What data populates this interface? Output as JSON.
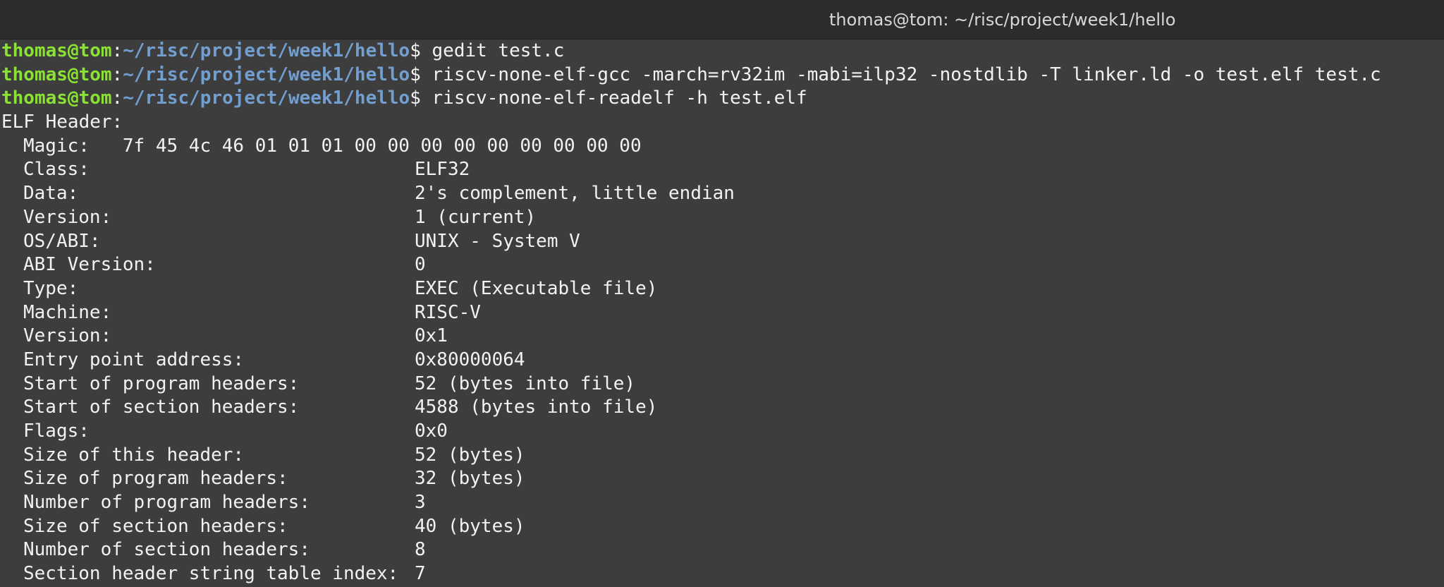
{
  "window": {
    "title": "thomas@tom: ~/risc/project/week1/hello"
  },
  "colors": {
    "background": "#3d3d3d",
    "titlebar": "#2c2c2c",
    "prompt_user": "#8ae234",
    "prompt_path": "#729fcf",
    "text": "#f2f2f2"
  },
  "prompt": {
    "user_host": "thomas@tom",
    "separator": ":",
    "path": "~/risc/project/week1/hello",
    "symbol": "$"
  },
  "commands": [
    " gedit test.c",
    " riscv-none-elf-gcc -march=rv32im -mabi=ilp32 -nostdlib -T linker.ld -o test.elf test.c",
    " riscv-none-elf-readelf -h test.elf"
  ],
  "elf_header": {
    "heading": "ELF Header:",
    "magic_label": "Magic:",
    "magic_value": "7f 45 4c 46 01 01 01 00 00 00 00 00 00 00 00 00",
    "fields": [
      {
        "label": "Class:",
        "value": "ELF32"
      },
      {
        "label": "Data:",
        "value": "2's complement, little endian"
      },
      {
        "label": "Version:",
        "value": "1 (current)"
      },
      {
        "label": "OS/ABI:",
        "value": "UNIX - System V"
      },
      {
        "label": "ABI Version:",
        "value": "0"
      },
      {
        "label": "Type:",
        "value": "EXEC (Executable file)"
      },
      {
        "label": "Machine:",
        "value": "RISC-V"
      },
      {
        "label": "Version:",
        "value": "0x1"
      },
      {
        "label": "Entry point address:",
        "value": "0x80000064"
      },
      {
        "label": "Start of program headers:",
        "value": "52 (bytes into file)"
      },
      {
        "label": "Start of section headers:",
        "value": "4588 (bytes into file)"
      },
      {
        "label": "Flags:",
        "value": "0x0"
      },
      {
        "label": "Size of this header:",
        "value": "52 (bytes)"
      },
      {
        "label": "Size of program headers:",
        "value": "32 (bytes)"
      },
      {
        "label": "Number of program headers:",
        "value": "3"
      },
      {
        "label": "Size of section headers:",
        "value": "40 (bytes)"
      },
      {
        "label": "Number of section headers:",
        "value": "8"
      },
      {
        "label": "Section header string table index:",
        "value": "7"
      }
    ]
  }
}
